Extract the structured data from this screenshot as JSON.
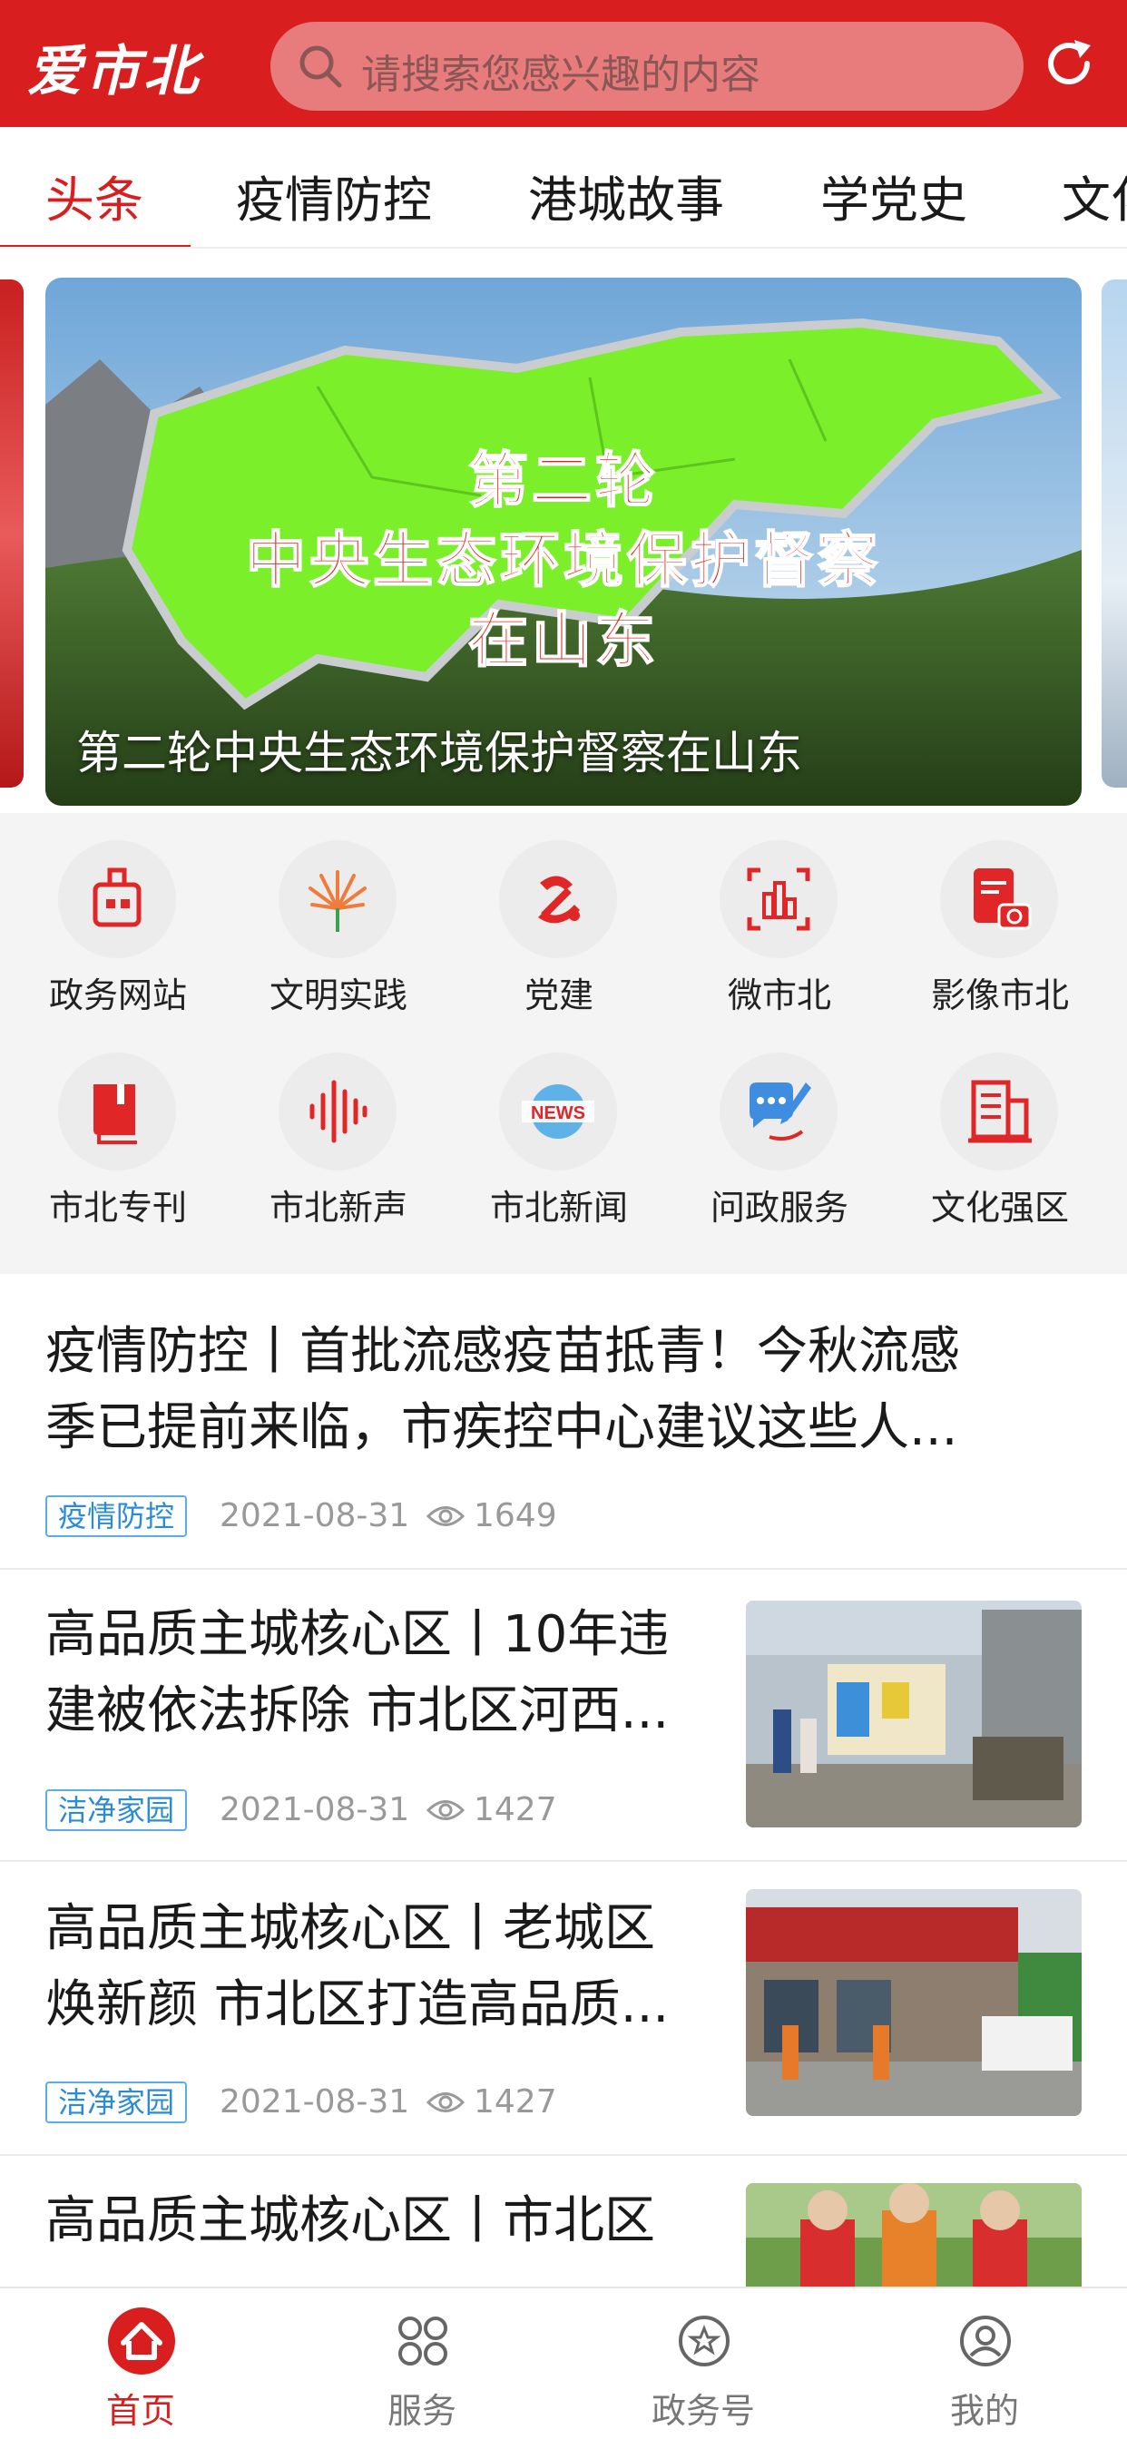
{
  "app": {
    "logo": "爱市北",
    "search_placeholder": "请搜索您感兴趣的内容",
    "brand_color": "#d81e1e"
  },
  "tabs": [
    {
      "label": "头条",
      "active": true
    },
    {
      "label": "疫情防控",
      "active": false
    },
    {
      "label": "港城故事",
      "active": false
    },
    {
      "label": "学党史",
      "active": false
    },
    {
      "label": "文化",
      "active": false
    }
  ],
  "banner": {
    "overlay_line1": "第二轮",
    "overlay_line2": "中央生态环境保护督察",
    "overlay_line3": "在山东",
    "caption": "第二轮中央生态环境保护督察在山东"
  },
  "services": [
    {
      "label": "政务网站",
      "icon": "government-building-icon"
    },
    {
      "label": "文明实践",
      "icon": "civilization-practice-icon"
    },
    {
      "label": "党建",
      "icon": "party-emblem-icon"
    },
    {
      "label": "微市北",
      "icon": "micro-city-icon"
    },
    {
      "label": "影像市北",
      "icon": "photo-card-icon"
    },
    {
      "label": "市北专刊",
      "icon": "book-icon"
    },
    {
      "label": "市北新声",
      "icon": "sound-wave-icon"
    },
    {
      "label": "市北新闻",
      "icon": "news-globe-icon"
    },
    {
      "label": "问政服务",
      "icon": "chat-pen-icon"
    },
    {
      "label": "文化强区",
      "icon": "document-building-icon"
    }
  ],
  "news": [
    {
      "title_line1": "疫情防控丨首批流感疫苗抵青！今秋流感",
      "title_line2": "季已提前来临，市疾控中心建议这些人...",
      "tag": "疫情防控",
      "date": "2021-08-31",
      "views": "1649",
      "has_image": false
    },
    {
      "title_line1": "高品质主城核心区丨10年违",
      "title_line2": "建被依法拆除 市北区河西...",
      "tag": "洁净家园",
      "date": "2021-08-31",
      "views": "1427",
      "has_image": true
    },
    {
      "title_line1": "高品质主城核心区丨老城区",
      "title_line2": "焕新颜 市北区打造高品质...",
      "tag": "洁净家园",
      "date": "2021-08-31",
      "views": "1427",
      "has_image": true
    },
    {
      "title_line1": "高品质主城核心区丨市北区",
      "title_line2": "",
      "tag": "",
      "date": "",
      "views": "",
      "has_image": true
    }
  ],
  "bottom_nav": [
    {
      "label": "首页",
      "icon": "home-icon",
      "active": true
    },
    {
      "label": "服务",
      "icon": "services-grid-icon",
      "active": false
    },
    {
      "label": "政务号",
      "icon": "government-account-icon",
      "active": false
    },
    {
      "label": "我的",
      "icon": "profile-icon",
      "active": false
    }
  ]
}
